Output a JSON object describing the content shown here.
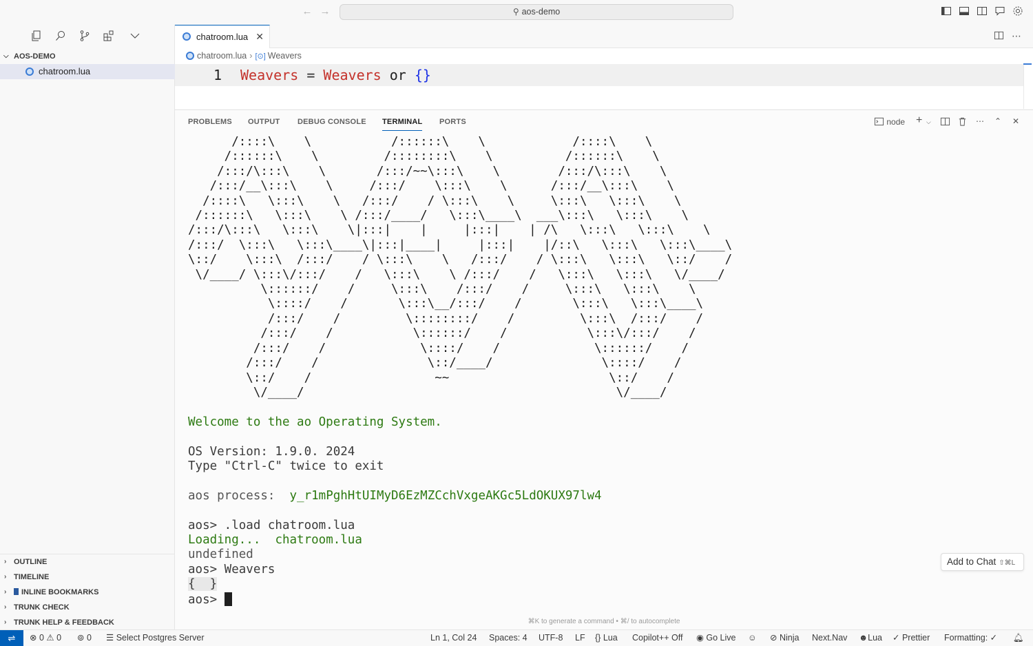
{
  "titlebar": {
    "search_text": "aos-demo",
    "back_icon": "arrow-left-icon",
    "forward_icon": "arrow-right-icon"
  },
  "sidebar": {
    "explorer_title": "AOS-DEMO",
    "files": [
      {
        "name": "chatroom.lua",
        "icon": "lua-file-icon"
      }
    ],
    "sections": [
      {
        "label": "OUTLINE"
      },
      {
        "label": "TIMELINE"
      },
      {
        "label": "INLINE BOOKMARKS"
      },
      {
        "label": "TRUNK CHECK"
      },
      {
        "label": "TRUNK HELP & FEEDBACK"
      }
    ]
  },
  "editor": {
    "tab_label": "chatroom.lua",
    "breadcrumb": {
      "file": "chatroom.lua",
      "symbol": "Weavers"
    },
    "line_number": "1",
    "code": {
      "var1": "Weavers",
      "eq": " = ",
      "var2": "Weavers",
      "kw": " or ",
      "br": "{}"
    }
  },
  "panel": {
    "tabs": [
      "PROBLEMS",
      "OUTPUT",
      "DEBUG CONSOLE",
      "TERMINAL",
      "PORTS"
    ],
    "active_tab": "TERMINAL",
    "terminal_name": "node",
    "ascii_art": "      /::::\\    \\           /::::::\\    \\            /::::\\    \\\n     /::::::\\    \\         /::::::::\\    \\          /::::::\\    \\\n    /:::/\\:::\\    \\       /:::/~~\\:::\\    \\        /:::/\\:::\\    \\\n   /:::/__\\:::\\    \\     /:::/    \\:::\\    \\      /:::/__\\:::\\    \\\n  /::::\\   \\:::\\    \\   /:::/    / \\:::\\    \\     \\:::\\   \\:::\\    \\\n /::::::\\   \\:::\\    \\ /:::/____/   \\:::\\____\\  ___\\:::\\   \\:::\\    \\\n/:::/\\:::\\   \\:::\\    \\|:::|    |     |:::|    | /\\   \\:::\\   \\:::\\    \\\n/:::/  \\:::\\   \\:::\\____\\|:::|____|     |:::|    |/::\\   \\:::\\   \\:::\\____\\\n\\::/    \\:::\\  /:::/    / \\:::\\    \\   /:::/    / \\:::\\   \\:::\\   \\::/    /\n \\/____/ \\:::\\/:::/    /   \\:::\\    \\ /:::/    /   \\:::\\   \\:::\\   \\/____/\n          \\::::::/    /     \\:::\\    /:::/    /     \\:::\\   \\:::\\    \\\n           \\::::/    /       \\:::\\__/:::/    /       \\:::\\   \\:::\\____\\\n           /:::/    /         \\::::::::/    /         \\:::\\  /:::/    /\n          /:::/    /           \\::::::/    /           \\:::\\/:::/    /\n         /:::/    /             \\::::/    /             \\::::::/    /\n        /:::/    /               \\::/____/               \\::::/    /\n        \\::/    /                 ~~                      \\::/    /\n         \\/____/                                           \\/____/",
    "welcome": "Welcome to the ao Operating System.",
    "os_version": "OS Version: 1.9.0. 2024",
    "exit_hint": "Type \"Ctrl-C\" twice to exit",
    "process_label": "aos process:  ",
    "process_id": "y_r1mPghHtUIMyD6EzMZCchVxgeAKGc5LdOKUX97lw4",
    "cmd1": "aos> .load chatroom.lua",
    "loading_label": "Loading...  ",
    "loading_file": "chatroom.lua",
    "undefined": "undefined",
    "cmd2": "aos> Weavers",
    "result": "{  }",
    "prompt": "aos> ",
    "hint": "⌘K to generate a command • ⌘/ to autocomplete",
    "add_chat": "Add to Chat",
    "add_chat_kbd": "⇧⌘L"
  },
  "statusbar": {
    "errors": "0",
    "warnings": "0",
    "ports": "0",
    "postgres": "Select Postgres Server",
    "position": "Ln 1, Col 24",
    "spaces": "Spaces: 4",
    "encoding": "UTF-8",
    "eol": "LF",
    "language": "Lua",
    "copilot": "Copilot++ Off",
    "golive": "Go Live",
    "ninja": "Ninja",
    "nextnav": "Next.Nav",
    "lua_status": "Lua",
    "prettier": "Prettier",
    "formatting": "Formatting: ✓"
  },
  "colors": {
    "accent": "#005fb8",
    "terminal_green": "#2d7a12",
    "code_var": "#c4322b",
    "code_brace": "#1e33e6"
  }
}
